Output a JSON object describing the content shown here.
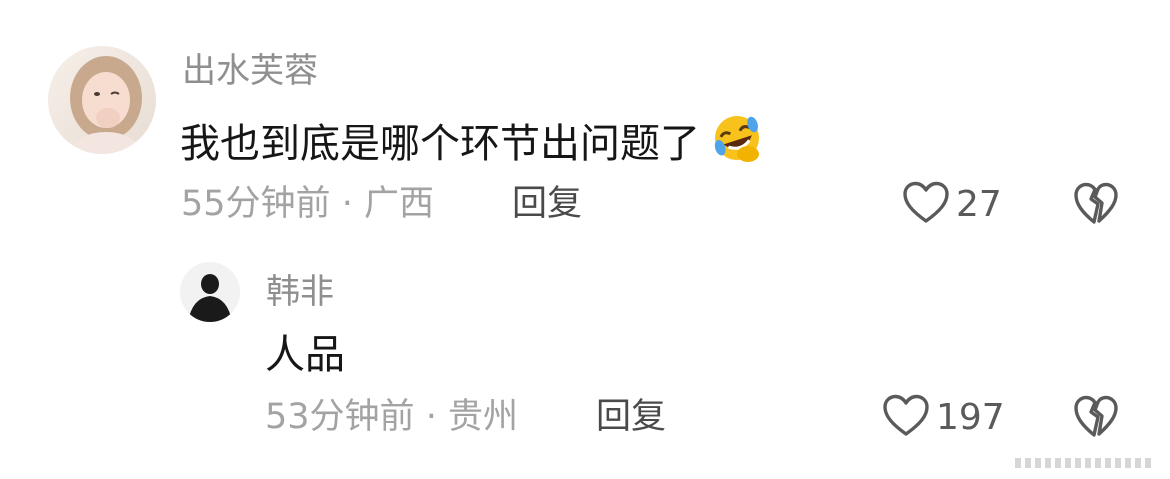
{
  "comments": [
    {
      "username": "出水芙蓉",
      "text": "我也到底是哪个环节出问题了",
      "emoji": "rolling-on-floor-laughing-emoji",
      "time": "55分钟前",
      "location": "广西",
      "meta_sep": "·",
      "reply_label": "回复",
      "likes": "27"
    }
  ],
  "replies": [
    {
      "username": "韩非",
      "text": "人品",
      "time": "53分钟前",
      "location": "贵州",
      "meta_sep": "·",
      "reply_label": "回复",
      "likes": "197"
    }
  ],
  "colors": {
    "username": "#8f8f8f",
    "text": "#161616",
    "meta": "#a3a3a3",
    "icon": "#5a5a5a"
  }
}
